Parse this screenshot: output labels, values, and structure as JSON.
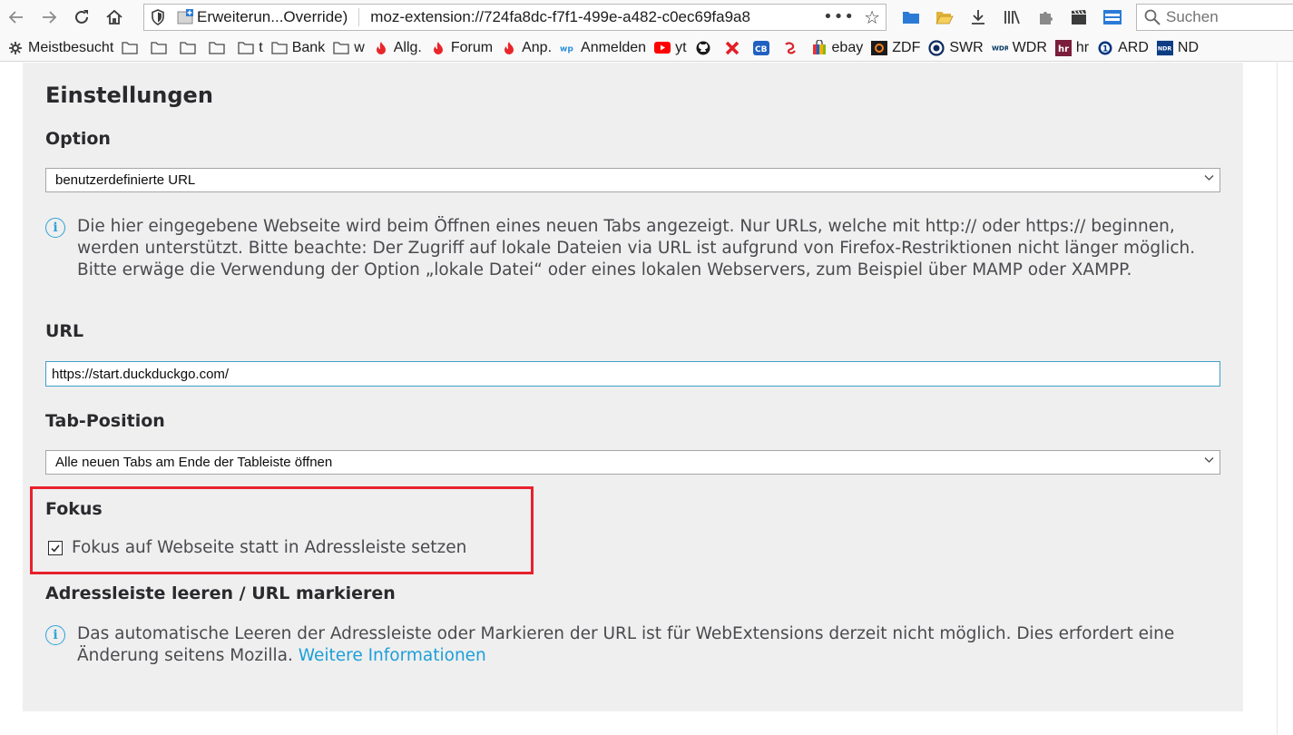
{
  "browser": {
    "extension_title": "Erweiterun...Override)",
    "url": "moz-extension://724fa8dc-f7f1-499e-a482-c0ec69fa9a8",
    "search_placeholder": "Suchen"
  },
  "bookmarks": [
    {
      "label": "Meistbesucht",
      "icon": "gear-icon"
    },
    {
      "label": "",
      "icon": "folder-icon"
    },
    {
      "label": "",
      "icon": "folder-icon"
    },
    {
      "label": "",
      "icon": "folder-icon"
    },
    {
      "label": "",
      "icon": "folder-icon"
    },
    {
      "label": "t",
      "icon": "folder-icon"
    },
    {
      "label": "Bank",
      "icon": "folder-icon"
    },
    {
      "label": "w",
      "icon": "folder-icon"
    },
    {
      "label": "Allg.",
      "icon": "flame-icon"
    },
    {
      "label": "Forum",
      "icon": "flame-icon"
    },
    {
      "label": "Anp.",
      "icon": "flame-icon"
    },
    {
      "label": "Anmelden",
      "icon": "wp-icon"
    },
    {
      "label": "yt",
      "icon": "youtube-icon"
    },
    {
      "label": "",
      "icon": "github-icon"
    },
    {
      "label": "",
      "icon": "x-icon"
    },
    {
      "label": "",
      "icon": "cb-icon"
    },
    {
      "label": "",
      "icon": "swirl-icon"
    },
    {
      "label": "ebay",
      "icon": "bag-icon"
    },
    {
      "label": "ZDF",
      "icon": "zdf-icon"
    },
    {
      "label": "SWR",
      "icon": "swr-icon"
    },
    {
      "label": "WDR",
      "icon": "wdr-icon"
    },
    {
      "label": "hr",
      "icon": "hr-icon"
    },
    {
      "label": "ARD",
      "icon": "ard-icon"
    },
    {
      "label": "ND",
      "icon": "ndr-icon"
    }
  ],
  "settings": {
    "title": "Einstellungen",
    "option": {
      "heading": "Option",
      "selected": "benutzerdefinierte URL",
      "info": "Die hier eingegebene Webseite wird beim Öffnen eines neuen Tabs angezeigt. Nur URLs, welche mit http:// oder https:// beginnen, werden unterstützt. Bitte beachte: Der Zugriff auf lokale Dateien via URL ist aufgrund von Firefox-Restriktionen nicht länger möglich. Bitte erwäge die Verwendung der Option „lokale Datei“ oder eines lokalen Webservers, zum Beispiel über MAMP oder XAMPP."
    },
    "url": {
      "heading": "URL",
      "value": "https://start.duckduckgo.com/"
    },
    "tab_position": {
      "heading": "Tab-Position",
      "selected": "Alle neuen Tabs am Ende der Tableiste öffnen"
    },
    "focus": {
      "heading": "Fokus",
      "checkbox_label": "Fokus auf Webseite statt in Adressleiste setzen",
      "checked": true
    },
    "clear_addressbar": {
      "heading": "Adressleiste leeren / URL markieren",
      "info": "Das automatische Leeren der Adressleiste oder Markieren der URL ist für WebExtensions derzeit nicht möglich. Dies erfordert eine Änderung seitens Mozilla.",
      "link": "Weitere Informationen"
    }
  },
  "colors": {
    "highlight": "#e8212d",
    "link": "#1c9fd8",
    "info_icon": "#2ea3d8"
  }
}
